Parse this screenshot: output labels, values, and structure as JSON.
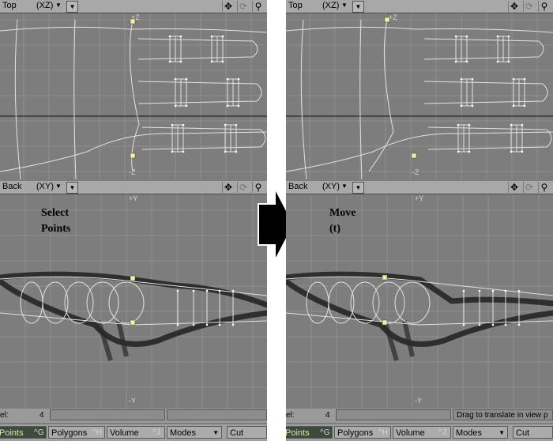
{
  "left": {
    "top_view": {
      "name": "Top",
      "axis": "(XZ)"
    },
    "back_view": {
      "name": "Back",
      "axis": "(XY)"
    },
    "labels": {
      "top_axis_pos": "+Z",
      "top_axis_neg": "-Z",
      "back_axis_pos": "+Y",
      "back_axis_neg": "-Y"
    },
    "overlay": "Select\nPoints",
    "status": {
      "sel_label": "el:",
      "sel_count": "4",
      "message": ""
    }
  },
  "right": {
    "top_view": {
      "name": "Top",
      "axis": "(XZ)"
    },
    "back_view": {
      "name": "Back",
      "axis": "(XY)"
    },
    "labels": {
      "top_axis_pos": "+Z",
      "top_axis_neg": "-Z",
      "back_axis_pos": "+Y",
      "back_axis_neg": "-Y"
    },
    "overlay": "Move\n(t)",
    "status": {
      "sel_label": "el:",
      "sel_count": "4",
      "message": "Drag to translate in view p"
    }
  },
  "toolbar": {
    "points": "Points",
    "points_key": "^G",
    "polygons": "Polygons",
    "polygons_key": "^H",
    "volume": "Volume",
    "volume_key": "^J",
    "modes": "Modes",
    "cut": "Cut"
  },
  "icons": {
    "move": "four-way-arrow-icon",
    "rotate": "rotate-icon",
    "zoom": "magnifier-icon",
    "menu": "dropdown-arrow-icon",
    "transition": "right-arrow-icon"
  },
  "colors": {
    "viewport_bg": "#7d7d7d",
    "header_bg": "#a8a8a8",
    "grid": "#8e8e8e",
    "wire": "#e6e6e6",
    "selected_point": "#f0f0a0",
    "active_mode": "#3e4a3e"
  }
}
